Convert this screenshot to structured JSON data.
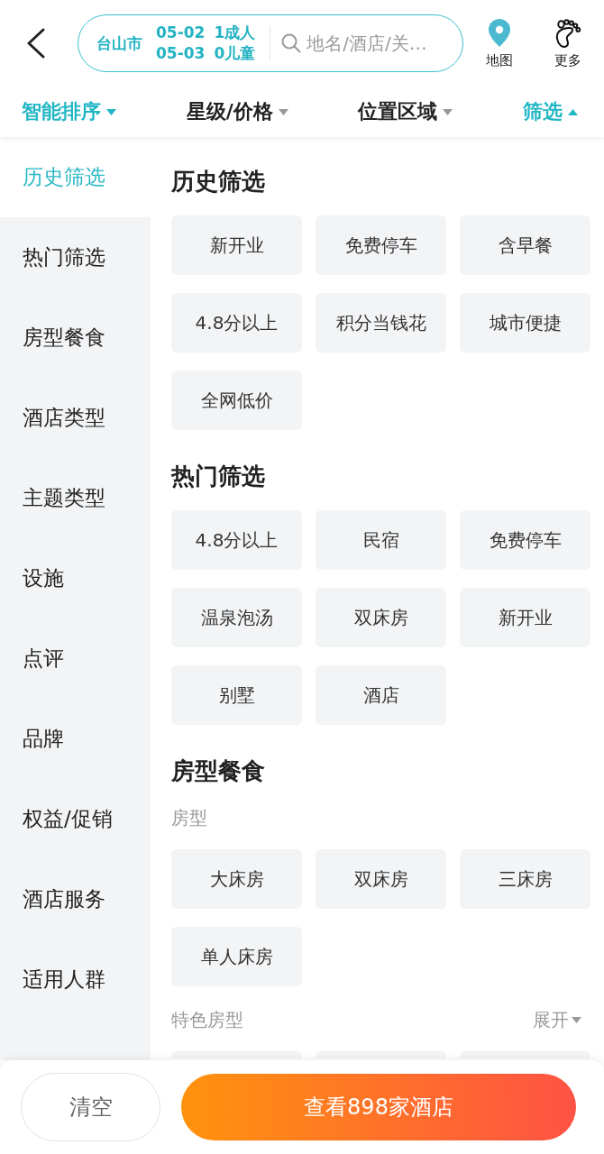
{
  "search_bar": {
    "city": "台山市",
    "check_in": "05-02",
    "check_out": "05-03",
    "adults": "1成人",
    "children": "0儿童",
    "placeholder": "地名/酒店/关…"
  },
  "header_actions": [
    {
      "kind": "map",
      "label": "地图"
    },
    {
      "kind": "more",
      "label": "更多"
    }
  ],
  "filter_tabs": [
    {
      "label": "智能排序",
      "active": true,
      "expanded": false
    },
    {
      "label": "星级/价格",
      "active": false,
      "expanded": false
    },
    {
      "label": "位置区域",
      "active": false,
      "expanded": false
    },
    {
      "label": "筛选",
      "active": true,
      "expanded": true
    }
  ],
  "sidebar": {
    "items": [
      {
        "label": "历史筛选",
        "selected": true
      },
      {
        "label": "热门筛选",
        "selected": false
      },
      {
        "label": "房型餐食",
        "selected": false
      },
      {
        "label": "酒店类型",
        "selected": false
      },
      {
        "label": "主题类型",
        "selected": false
      },
      {
        "label": "设施",
        "selected": false
      },
      {
        "label": "点评",
        "selected": false
      },
      {
        "label": "品牌",
        "selected": false
      },
      {
        "label": "权益/促销",
        "selected": false
      },
      {
        "label": "酒店服务",
        "selected": false
      },
      {
        "label": "适用人群",
        "selected": false
      }
    ]
  },
  "sections": [
    {
      "title": "历史筛选",
      "options": [
        {
          "label": "新开业",
          "selected": false
        },
        {
          "label": "免费停车",
          "selected": false
        },
        {
          "label": "含早餐",
          "selected": false
        },
        {
          "label": "4.8分以上",
          "selected": false
        },
        {
          "label": "积分当钱花",
          "selected": false
        },
        {
          "label": "城市便捷",
          "selected": false
        },
        {
          "label": "全网低价",
          "selected": false
        }
      ]
    },
    {
      "title": "热门筛选",
      "options": [
        {
          "label": "4.8分以上",
          "selected": false
        },
        {
          "label": "民宿",
          "selected": false
        },
        {
          "label": "免费停车",
          "selected": false
        },
        {
          "label": "温泉泡汤",
          "selected": false
        },
        {
          "label": "双床房",
          "selected": false
        },
        {
          "label": "新开业",
          "selected": false
        },
        {
          "label": "别墅",
          "selected": false
        },
        {
          "label": "酒店",
          "selected": false
        }
      ]
    },
    {
      "title": "房型餐食",
      "groups": [
        {
          "title": "房型",
          "options": [
            {
              "label": "大床房",
              "selected": false
            },
            {
              "label": "双床房",
              "selected": false
            },
            {
              "label": "三床房",
              "selected": false
            },
            {
              "label": "单人床房",
              "selected": false
            }
          ]
        },
        {
          "title": "特色房型",
          "toggle": "展开",
          "expanded": false,
          "more_below": true
        }
      ]
    }
  ],
  "footer": {
    "clear_button": "清空",
    "submit_button": "查看898家酒店"
  }
}
